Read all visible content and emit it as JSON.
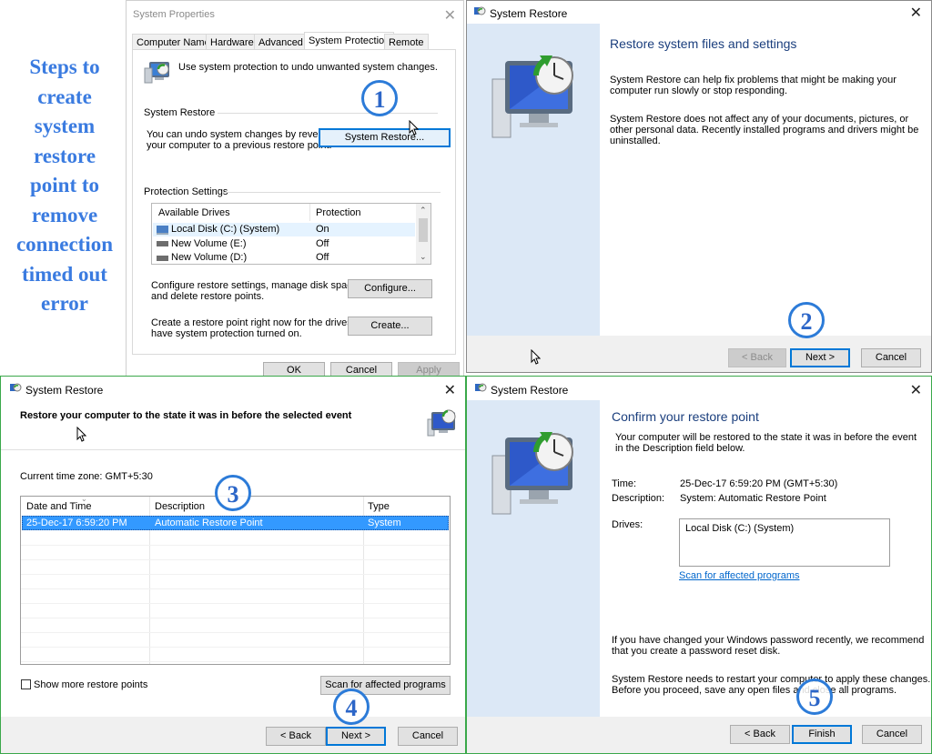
{
  "caption": {
    "lines": [
      "Steps to",
      "create",
      "system",
      "restore",
      "point to",
      "remove",
      "connection",
      "timed out",
      "error"
    ],
    "color": "#3a7be0"
  },
  "badges": [
    "1",
    "2",
    "3",
    "4",
    "5"
  ],
  "sysprops": {
    "title": "System Properties",
    "tabs": [
      "Computer Name",
      "Hardware",
      "Advanced",
      "System Protection",
      "Remote"
    ],
    "intro": "Use system protection to undo unwanted system changes.",
    "restore_group": "System Restore",
    "restore_text": [
      "You can undo system changes by reverting",
      "your computer to a previous restore point."
    ],
    "restore_button": "System Restore...",
    "protection_group": "Protection Settings",
    "columns": [
      "Available Drives",
      "Protection"
    ],
    "drives": [
      {
        "name": "Local Disk (C:) (System)",
        "protection": "On"
      },
      {
        "name": "New Volume (E:)",
        "protection": "Off"
      },
      {
        "name": "New Volume (D:)",
        "protection": "Off"
      }
    ],
    "configure_text": [
      "Configure restore settings, manage disk space,",
      "and delete restore points."
    ],
    "configure_button": "Configure...",
    "create_text": [
      "Create a restore point right now for the drives that",
      "have system protection turned on."
    ],
    "create_button": "Create...",
    "ok": "OK",
    "cancel": "Cancel",
    "apply": "Apply"
  },
  "wizard1": {
    "title": "System Restore",
    "heading": "Restore system files and settings",
    "p1": [
      "System Restore can help fix problems that might be making your",
      "computer run slowly or stop responding."
    ],
    "p2": [
      "System Restore does not affect any of your documents, pictures, or",
      "other personal data. Recently installed programs and drivers might be",
      "uninstalled."
    ],
    "back": "< Back",
    "next": "Next >",
    "cancel": "Cancel"
  },
  "wizard2": {
    "title": "System Restore",
    "heading": "Restore your computer to the state it was in before the selected event",
    "timezone": "Current time zone: GMT+5:30",
    "columns": [
      "Date and Time",
      "Description",
      "Type"
    ],
    "rows": [
      {
        "date": "25-Dec-17 6:59:20 PM",
        "description": "Automatic Restore Point",
        "type": "System"
      }
    ],
    "show_more": "Show more restore points",
    "scan": "Scan for affected programs",
    "back": "< Back",
    "next": "Next >",
    "cancel": "Cancel"
  },
  "wizard3": {
    "title": "System Restore",
    "heading": "Confirm your restore point",
    "intro": [
      "Your computer will be restored to the state it was in before the event",
      "in the Description field below."
    ],
    "time_label": "Time:",
    "time_value": "25-Dec-17 6:59:20 PM (GMT+5:30)",
    "desc_label": "Description:",
    "desc_value": "System: Automatic Restore Point",
    "drives_label": "Drives:",
    "drives_value": "Local Disk (C:) (System)",
    "scan_link": "Scan for affected programs",
    "note1": [
      "If you have changed your Windows password recently, we recommend",
      "that you create a password reset disk."
    ],
    "note2": [
      "System Restore needs to restart your computer to apply these changes.",
      "Before you proceed, save any open files and close all programs."
    ],
    "back": "< Back",
    "finish": "Finish",
    "cancel": "Cancel"
  }
}
